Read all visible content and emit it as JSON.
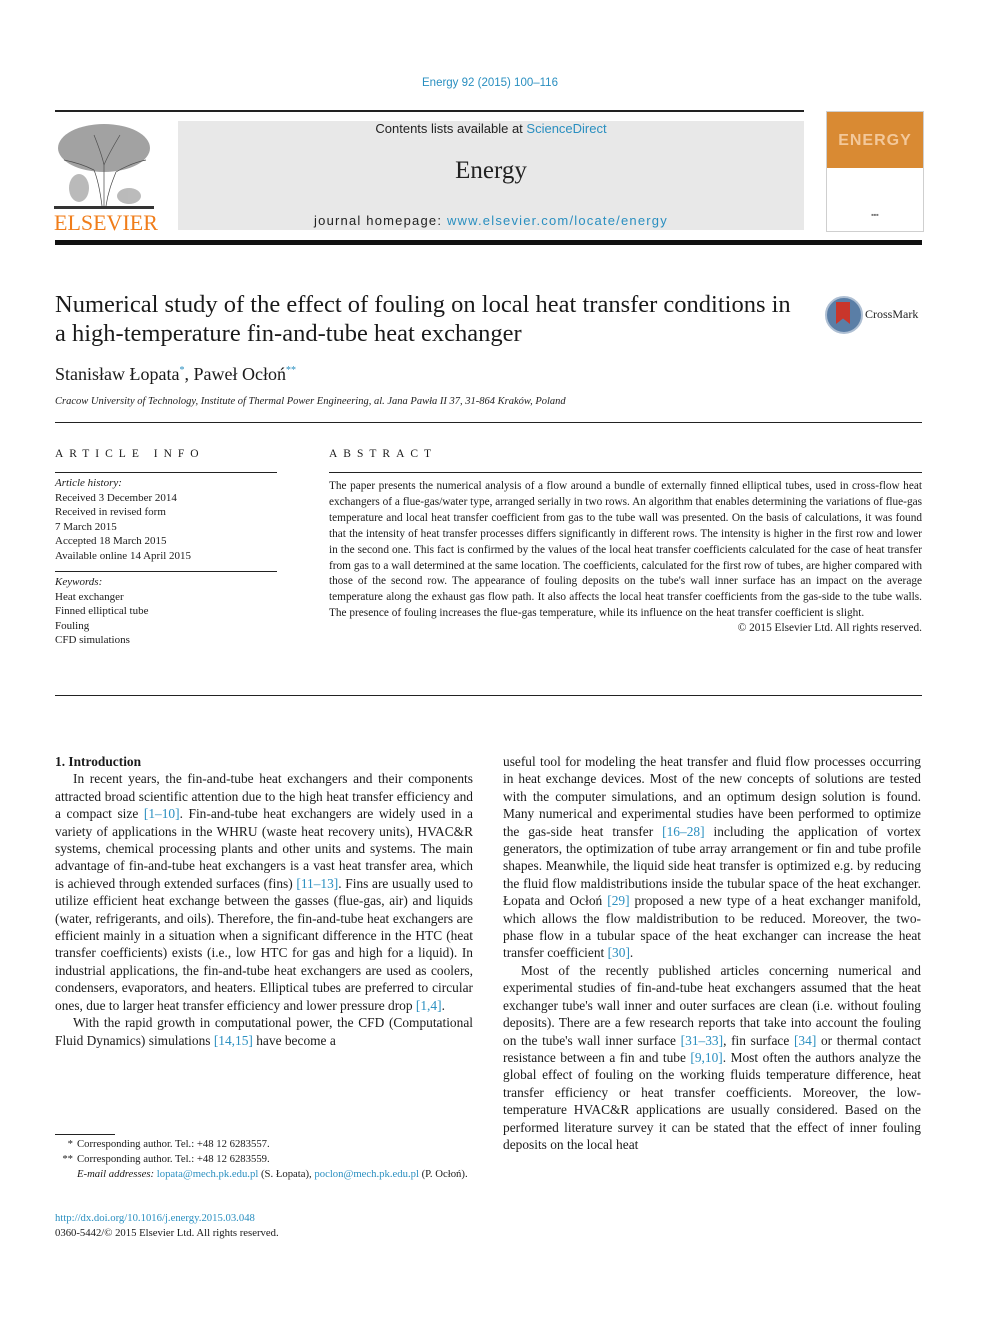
{
  "header": {
    "citation": "Energy 92 (2015) 100–116",
    "contents_prefix": "Contents lists available at ",
    "contents_link": "ScienceDirect",
    "journal_name": "Energy",
    "homepage_prefix": "journal homepage: ",
    "homepage_link": "www.elsevier.com/locate/energy",
    "publisher_logo_text": "ELSEVIER",
    "cover_title": "ENERGY",
    "brand_color": "#f07d1a",
    "link_color": "#2a8fc0",
    "cover_color": "#d98a33"
  },
  "article": {
    "title": "Numerical study of the effect of fouling on local heat transfer conditions in a high-temperature fin-and-tube heat exchanger",
    "crossmark_label": "CrossMark",
    "authors": [
      {
        "name": "Stanisław Łopata",
        "mark": "*"
      },
      {
        "name": "Paweł Ocłoń",
        "mark": "**"
      }
    ],
    "author_separator": ", ",
    "affiliation": "Cracow University of Technology, Institute of Thermal Power Engineering, al. Jana Pawła II 37, 31-864 Kraków, Poland"
  },
  "article_info": {
    "heading": "ARTICLE INFO",
    "history_label": "Article history:",
    "history": [
      "Received 3 December 2014",
      "Received in revised form",
      "7 March 2015",
      "Accepted 18 March 2015",
      "Available online 14 April 2015"
    ],
    "keywords_label": "Keywords:",
    "keywords": [
      "Heat exchanger",
      "Finned elliptical tube",
      "Fouling",
      "CFD simulations"
    ]
  },
  "abstract": {
    "heading": "ABSTRACT",
    "text": "The paper presents the numerical analysis of a flow around a bundle of externally finned elliptical tubes, used in cross-flow heat exchangers of a flue-gas/water type, arranged serially in two rows. An algorithm that enables determining the variations of flue-gas temperature and local heat transfer coefficient from gas to the tube wall was presented. On the basis of calculations, it was found that the intensity of heat transfer processes differs significantly in different rows. The intensity is higher in the first row and lower in the second one. This fact is confirmed by the values of the local heat transfer coefficients calculated for the case of heat transfer from gas to a wall determined at the same location. The coefficients, calculated for the first row of tubes, are higher compared with those of the second row. The appearance of fouling deposits on the tube's wall inner surface has an impact on the average temperature along the exhaust gas flow path. It also affects the local heat transfer coefficients from the gas-side to the tube walls. The presence of fouling increases the flue-gas temperature, while its influence on the heat transfer coefficient is slight.",
    "copyright": "© 2015 Elsevier Ltd. All rights reserved."
  },
  "body": {
    "section_heading": "1.  Introduction",
    "left_paragraphs": [
      [
        {
          "t": "In recent years, the fin-and-tube heat exchangers and their components attracted broad scientific attention due to the high heat transfer efficiency and a compact size "
        },
        {
          "ref": "[1–10]"
        },
        {
          "t": ". Fin-and-tube heat exchangers are widely used in a variety of applications in the WHRU (waste heat recovery units), HVAC&R systems, chemical processing plants and other units and systems. The main advantage of fin-and-tube heat exchangers is a vast heat transfer area, which is achieved through extended surfaces (fins) "
        },
        {
          "ref": "[11–13]"
        },
        {
          "t": ". Fins are usually used to utilize efficient heat exchange between the gasses (flue-gas, air) and liquids (water, refrigerants, and oils). Therefore, the fin-and-tube heat exchangers are efficient mainly in a situation when a significant difference in the HTC (heat transfer coefficients) exists (i.e., low HTC for gas and high for a liquid). In industrial applications, the fin-and-tube heat exchangers are used as coolers, condensers, evaporators, and heaters. Elliptical tubes are preferred to circular ones, due to larger heat transfer efficiency and lower pressure drop "
        },
        {
          "ref": "[1,4]"
        },
        {
          "t": "."
        }
      ],
      [
        {
          "t": "With the rapid growth in computational power, the CFD (Computational Fluid Dynamics) simulations "
        },
        {
          "ref": "[14,15]"
        },
        {
          "t": " have become a"
        }
      ]
    ],
    "right_paragraphs": [
      [
        {
          "t": "useful tool for modeling the heat transfer and fluid flow processes occurring in heat exchange devices. Most of the new concepts of solutions are tested with the computer simulations, and an optimum design solution is found. Many numerical and experimental studies have been performed to optimize the gas-side heat transfer "
        },
        {
          "ref": "[16–28]"
        },
        {
          "t": " including the application of vortex generators, the optimization of tube array arrangement or fin and tube profile shapes. Meanwhile, the liquid side heat transfer is optimized e.g. by reducing the fluid flow maldistributions inside the tubular space of the heat exchanger. Łopata and Ocłoń "
        },
        {
          "ref": "[29]"
        },
        {
          "t": " proposed a new type of a heat exchanger manifold, which allows the flow maldistribution to be reduced. Moreover, the two-phase flow in a tubular space of the heat exchanger can increase the heat transfer coefficient "
        },
        {
          "ref": "[30]"
        },
        {
          "t": "."
        }
      ],
      [
        {
          "t": "Most of the recently published articles concerning numerical and experimental studies of fin-and-tube heat exchangers assumed that the heat exchanger tube's wall inner and outer surfaces are clean (i.e. without fouling deposits). There are a few research reports that take into account the fouling on the tube's wall inner surface "
        },
        {
          "ref": "[31–33]"
        },
        {
          "t": ", fin surface "
        },
        {
          "ref": "[34]"
        },
        {
          "t": " or thermal contact resistance between a fin and tube "
        },
        {
          "ref": "[9,10]"
        },
        {
          "t": ". Most often the authors analyze the global effect of fouling on the working fluids temperature difference, heat transfer efficiency or heat transfer coefficients. Moreover, the low-temperature HVAC&R applications are usually considered. Based on the performed literature survey it can be stated that the effect of inner fouling deposits on the local heat"
        }
      ]
    ]
  },
  "footnotes": {
    "items": [
      {
        "mark": "*",
        "text": "Corresponding author. Tel.: +48 12 6283557."
      },
      {
        "mark": "**",
        "text": "Corresponding author. Tel.: +48 12 6283559."
      }
    ],
    "email_label": "E-mail addresses:",
    "emails": [
      {
        "address": "lopata@mech.pk.edu.pl",
        "owner": " (S. Łopata), "
      },
      {
        "address": "poclon@mech.pk.edu.pl",
        "owner": " (P. Ocłoń)."
      }
    ],
    "doi": "http://dx.doi.org/10.1016/j.energy.2015.03.048",
    "issn_line": "0360-5442/© 2015 Elsevier Ltd. All rights reserved."
  }
}
